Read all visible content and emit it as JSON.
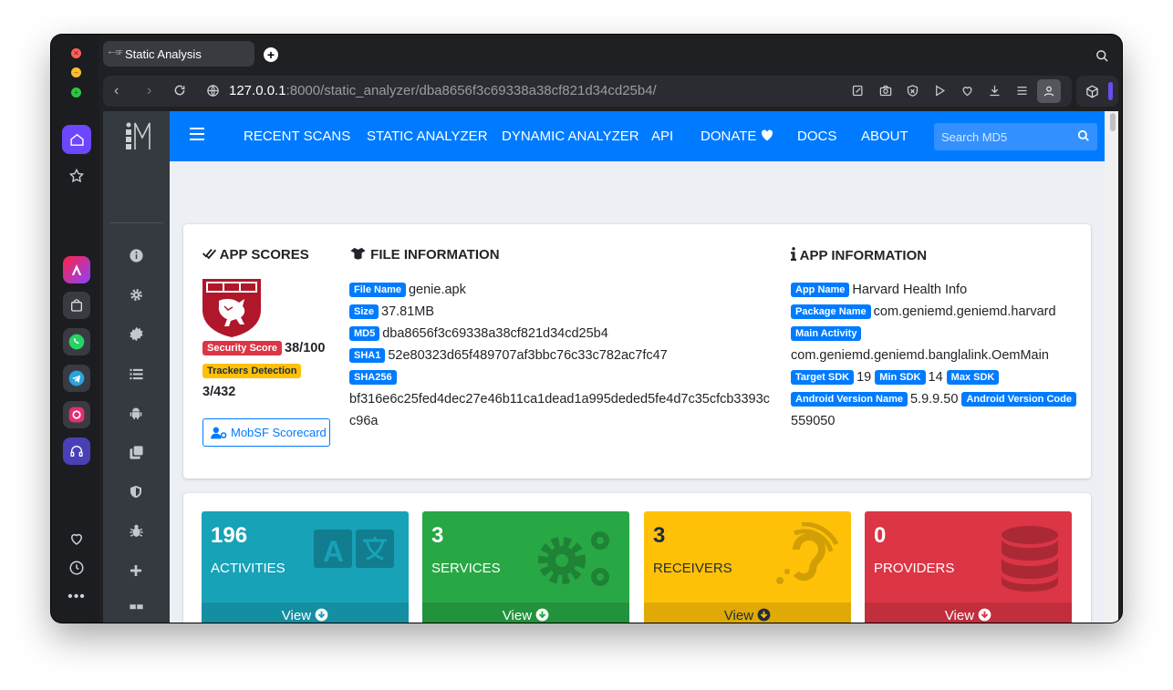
{
  "browser": {
    "tab_title": "Static Analysis",
    "tab_favicon_text": "•−−SF",
    "url_host": "127.0.0.1",
    "url_rest": ":8000/static_analyzer/dba8656f3c69338a38cf821d34cd25b4/"
  },
  "nav": {
    "links": [
      "RECENT SCANS",
      "STATIC ANALYZER",
      "DYNAMIC ANALYZER",
      "API",
      "DONATE",
      "DOCS",
      "ABOUT"
    ],
    "search_placeholder": "Search MD5"
  },
  "app_scores": {
    "title": "APP SCORES",
    "security_label": "Security Score",
    "security_value": "38/100",
    "trackers_label": "Trackers Detection",
    "trackers_value": "3/432",
    "scorecard_button": "MobSF Scorecard"
  },
  "file_info": {
    "title": "FILE INFORMATION",
    "file_name_label": "File Name",
    "file_name": "genie.apk",
    "size_label": "Size",
    "size": "37.81MB",
    "md5_label": "MD5",
    "md5": "dba8656f3c69338a38cf821d34cd25b4",
    "sha1_label": "SHA1",
    "sha1": "52e80323d65f489707af3bbc76c33c782ac7fc47",
    "sha256_label": "SHA256",
    "sha256_line1": "bf316e6c25fed4dec27e46b11ca1dead1a995deded5fe4d7c35cfcb3393c",
    "sha256_line2": "c96a"
  },
  "app_info": {
    "title": "APP INFORMATION",
    "app_name_label": "App Name",
    "app_name": "Harvard Health Info",
    "package_label": "Package Name",
    "package": "com.geniemd.geniemd.harvard",
    "main_activity_label": "Main Activity",
    "main_activity": "com.geniemd.geniemd.banglalink.OemMain",
    "target_sdk_label": "Target SDK",
    "target_sdk": "19",
    "min_sdk_label": "Min SDK",
    "min_sdk": "14",
    "max_sdk_label": "Max SDK",
    "version_name_label": "Android Version Name",
    "version_name": "5.9.9.50",
    "version_code_label": "Android Version Code",
    "version_code": "559050"
  },
  "stats": [
    {
      "count": "196",
      "label": "ACTIVITIES",
      "view": "View",
      "color": "#17a2b8"
    },
    {
      "count": "3",
      "label": "SERVICES",
      "view": "View",
      "color": "#28a745"
    },
    {
      "count": "3",
      "label": "RECEIVERS",
      "view": "View",
      "color": "#ffc107"
    },
    {
      "count": "0",
      "label": "PROVIDERS",
      "view": "View",
      "color": "#dc3545"
    }
  ]
}
